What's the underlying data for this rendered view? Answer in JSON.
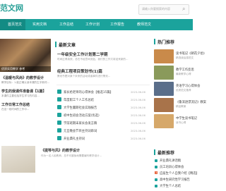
{
  "header": {
    "logo": "范文网",
    "search_placeholder": "请输入你要搜索的内容",
    "search_icon": "search-icon"
  },
  "nav": {
    "items": [
      "首页范文",
      "实用文档",
      "工作总结",
      "工作计划",
      "工作报告",
      "教师范文"
    ]
  },
  "left": {
    "image_caption": "优质实用教学 参考",
    "items": [
      {
        "title": "《温暖与风尚》的教学设计",
        "desc": "教学目标：1.能正确认读本课的生字新词..."
      },
      {
        "title": "学生的我课件准备课【1篇】",
        "desc": "本课件主要包括学生学习的内容..."
      },
      {
        "title": "工作日常工作总结",
        "desc": "在这一段时间的工作中..."
      }
    ],
    "bottom": {
      "title": "《提琴与风》的教学设计",
      "desc": "作为一名人民教师，总不可避免地需要编写教学设计..."
    }
  },
  "middle": {
    "heading": "最新文章",
    "featured": [
      {
        "title": "一年级安全工作计划第二学期",
        "desc": "时间过得真快，总在不经意间流逝，我们的工作又将迎来新的..."
      },
      {
        "title": "经典工程项目策划书(1)篇",
        "desc": "策划书是对某个未来的活动或者事件进行策划..."
      }
    ],
    "rows": [
      {
        "title": "家长给老师的心得体会【推选15篇】",
        "date": "2023-06-06"
      },
      {
        "title": "年度职工个人工作总结",
        "date": "2023-06-06"
      },
      {
        "title": "大学生暑期社会实践报告",
        "date": "2023-06-06"
      },
      {
        "title": "初中生班会活动方案(优选)",
        "date": "2023-06-06"
      },
      {
        "title": "学前班期末家长会发言稿",
        "date": "2023-06-06"
      },
      {
        "title": "元旦晚会节目主持词串词",
        "date": "2023-06-06"
      },
      {
        "title": "开业典礼主持词",
        "date": "2023-06-06"
      }
    ]
  },
  "right": {
    "hot_heading": "热门推荐",
    "hot_items": [
      {
        "title": "读书笔记《朝花夕拾》",
        "desc": "精选读后感范文"
      },
      {
        "title": "教学工作反思",
        "desc": "最新教学心得"
      },
      {
        "title": "英语学习心得体会",
        "desc": "优秀范文推荐"
      },
      {
        "title": "《鲁滨逊漂流记》教案",
        "desc": "精品教案"
      },
      {
        "title": "中学生读书笔记",
        "desc": "读书心得"
      }
    ],
    "rec_heading": "最新推荐",
    "rec_items": [
      {
        "title": "开业典礼讲话稿",
        "badge": ""
      },
      {
        "title": "员工培训心得体会",
        "badge": ""
      },
      {
        "title": "应届生个人自我介绍【精选】",
        "badge": "1"
      },
      {
        "title": "高中生研究性学习报告",
        "badge": ""
      },
      {
        "title": "大学生个人总结",
        "badge": ""
      }
    ]
  },
  "colors": {
    "accent": "#1ba39c"
  }
}
